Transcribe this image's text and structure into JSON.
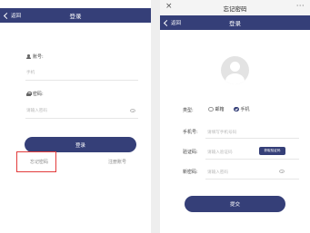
{
  "login_screen": {
    "header": {
      "back_label": "返回",
      "title": "登录"
    },
    "account": {
      "label": "账号:",
      "placeholder": "手机"
    },
    "password": {
      "label": "密码:",
      "placeholder": "请输入密码"
    },
    "login_button": "登录",
    "forgot_password_link": "忘记密码",
    "register_link": "注册账号"
  },
  "reset_screen": {
    "window_title": "忘记密码",
    "header": {
      "back_label": "返回",
      "title": "登录"
    },
    "type": {
      "label": "类型:",
      "options": [
        "邮箱",
        "手机"
      ],
      "selected": "手机"
    },
    "phone": {
      "label": "手机号:",
      "placeholder": "请填写手机号码"
    },
    "code": {
      "label": "验证码:",
      "placeholder": "请输入验证码",
      "button": "获取验证码"
    },
    "new_password": {
      "label": "新密码:",
      "placeholder": "请输入密码"
    },
    "submit_button": "提交"
  },
  "colors": {
    "accent": "#353f78",
    "highlight_box": "#e23b3b"
  }
}
